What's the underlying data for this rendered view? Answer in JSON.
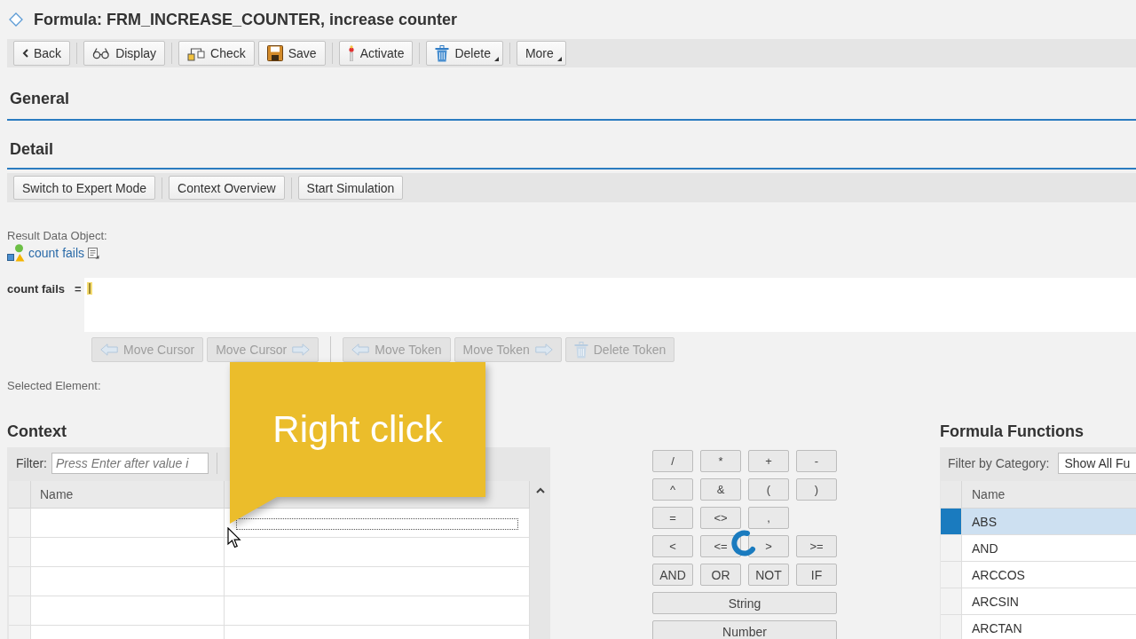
{
  "window": {
    "title": "Formula: FRM_INCREASE_COUNTER, increase counter"
  },
  "toolbar": [
    [
      {
        "label": "Back",
        "menu": false
      }
    ],
    [
      {
        "label": "Display",
        "menu": false
      }
    ],
    [
      {
        "label": "Check",
        "menu": false
      },
      {
        "label": "Save",
        "menu": false
      }
    ],
    [
      {
        "label": "Activate",
        "menu": false
      }
    ],
    [
      {
        "label": "Delete",
        "menu": true
      }
    ],
    [
      {
        "label": "More",
        "menu": true
      }
    ]
  ],
  "general": {
    "title": "General"
  },
  "detail": {
    "title": "Detail",
    "toolbar": [
      [
        "Switch to Expert Mode"
      ],
      [
        "Context Overview"
      ],
      [
        "Start Simulation"
      ]
    ],
    "result": {
      "label": "Result Data Object:",
      "link": "count fails"
    },
    "formula": {
      "label": "count fails",
      "operator": "="
    },
    "token_buttons": [
      [
        {
          "label": "Move Cursor",
          "disabled": true
        },
        {
          "label": "Move Cursor",
          "disabled": true
        }
      ],
      [
        {
          "label": "Move Token",
          "disabled": true
        },
        {
          "label": "Move Token",
          "disabled": true
        },
        {
          "label": "Delete Token",
          "disabled": true
        }
      ]
    ],
    "selected_element_label": "Selected Element:"
  },
  "context": {
    "title": "Context",
    "filter": {
      "label": "Filter:",
      "placeholder": "Press Enter after value i"
    },
    "table": {
      "columns": [
        "Name"
      ],
      "rows": [
        {
          "focused": true
        },
        {
          "focused": false
        },
        {
          "focused": false
        },
        {
          "focused": false
        },
        {
          "focused": false
        }
      ]
    }
  },
  "operators": [
    [
      "/",
      "*",
      "+",
      "-"
    ],
    [
      "^",
      "&",
      "(",
      ")"
    ],
    [
      "=",
      "<>",
      ","
    ],
    [
      "<",
      "<=",
      ">",
      ">="
    ],
    [
      "AND",
      "OR",
      "NOT",
      "IF"
    ],
    [
      "String"
    ],
    [
      "Number"
    ]
  ],
  "loading": true,
  "functions": {
    "title": "Formula Functions",
    "filter": {
      "label": "Filter by Category:",
      "value": "Show All Fu"
    },
    "table": {
      "columns": [
        "Name"
      ],
      "rows": [
        {
          "name": "ABS",
          "selected": true
        },
        {
          "name": "AND",
          "selected": false
        },
        {
          "name": "ARCCOS",
          "selected": false
        },
        {
          "name": "ARCSIN",
          "selected": false
        },
        {
          "name": "ARCTAN",
          "selected": false
        }
      ]
    }
  },
  "callout": {
    "text": "Right click"
  }
}
